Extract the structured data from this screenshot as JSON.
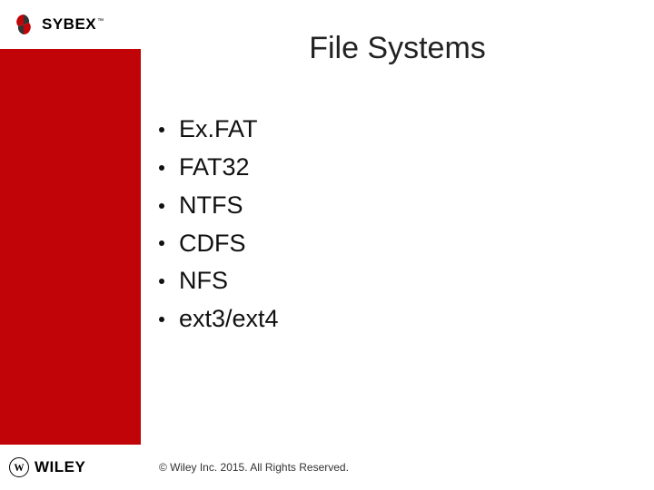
{
  "brand": {
    "top_name": "SYBEX",
    "top_tm": "™",
    "bottom_name": "WILEY"
  },
  "slide": {
    "title": "File Systems",
    "bullets": [
      "Ex.FAT",
      "FAT32",
      "NTFS",
      "CDFS",
      "NFS",
      "ext3/ext4"
    ],
    "footer": "© Wiley Inc. 2015. All Rights Reserved."
  }
}
